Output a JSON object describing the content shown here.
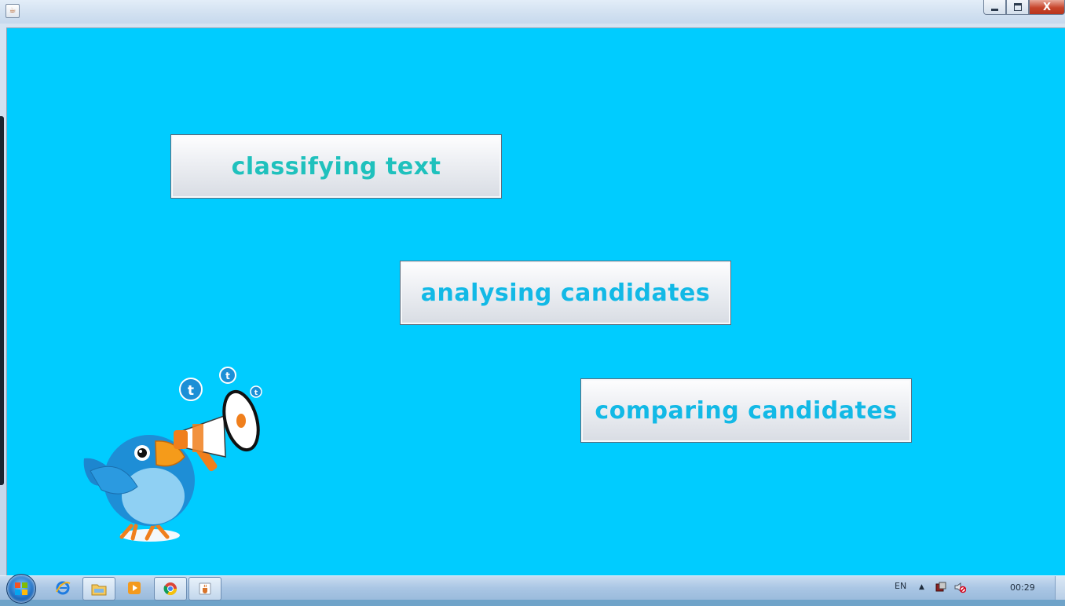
{
  "window": {
    "icon": "java-cup-icon",
    "controls": [
      "minimize-icon",
      "maximize-icon",
      "close-icon"
    ],
    "close_label": "X"
  },
  "app": {
    "background_color": "#00ccff",
    "buttons": [
      {
        "label": "classifying text",
        "color": "#1fc1bd"
      },
      {
        "label": "analysing candidates",
        "color": "#12b9e6"
      },
      {
        "label": "comparing candidates",
        "color": "#12b9e6"
      }
    ],
    "illustration": "twitter-bird-megaphone-icon"
  },
  "taskbar": {
    "start": "windows-start-icon",
    "apps": [
      "internet-explorer-icon",
      "folder-icon",
      "media-player-icon",
      "chrome-icon",
      "java-cup-icon"
    ],
    "language": "EN",
    "tray_icons": [
      "show-hidden-icons-arrow",
      "network-icon",
      "volume-muted-icon"
    ],
    "clock": "00:29"
  }
}
